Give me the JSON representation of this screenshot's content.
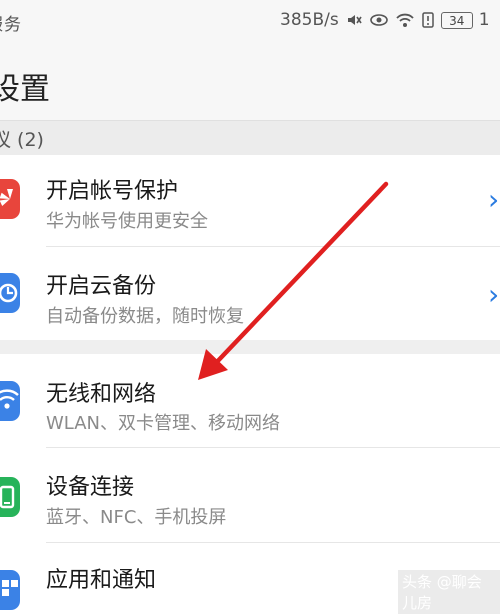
{
  "status_bar": {
    "carrier": "服务",
    "speed": "385B/s",
    "battery": "34",
    "extra": "1"
  },
  "header": {
    "title": "设置"
  },
  "section": {
    "title": "议 (2)"
  },
  "suggestions": [
    {
      "title": "开启帐号保护",
      "subtitle": "华为帐号使用更安全",
      "icon": "huawei-icon",
      "chevron": "›"
    },
    {
      "title": "开启云备份",
      "subtitle": "自动备份数据，随时恢复",
      "icon": "cloud-backup-icon",
      "chevron": "›"
    }
  ],
  "settings": [
    {
      "title": "无线和网络",
      "subtitle": "WLAN、双卡管理、移动网络",
      "icon": "wifi-icon"
    },
    {
      "title": "设备连接",
      "subtitle": "蓝牙、NFC、手机投屏",
      "icon": "device-connect-icon"
    },
    {
      "title": "应用和通知",
      "subtitle": "",
      "icon": "apps-icon"
    }
  ],
  "colors": {
    "huawei": "#e8453c",
    "cloud": "#3b82e6",
    "wifi": "#3b82e6",
    "device": "#27b35a",
    "apps": "#3b82e6",
    "arrow": "#e02020"
  },
  "watermark": "头条 @聊会儿房"
}
